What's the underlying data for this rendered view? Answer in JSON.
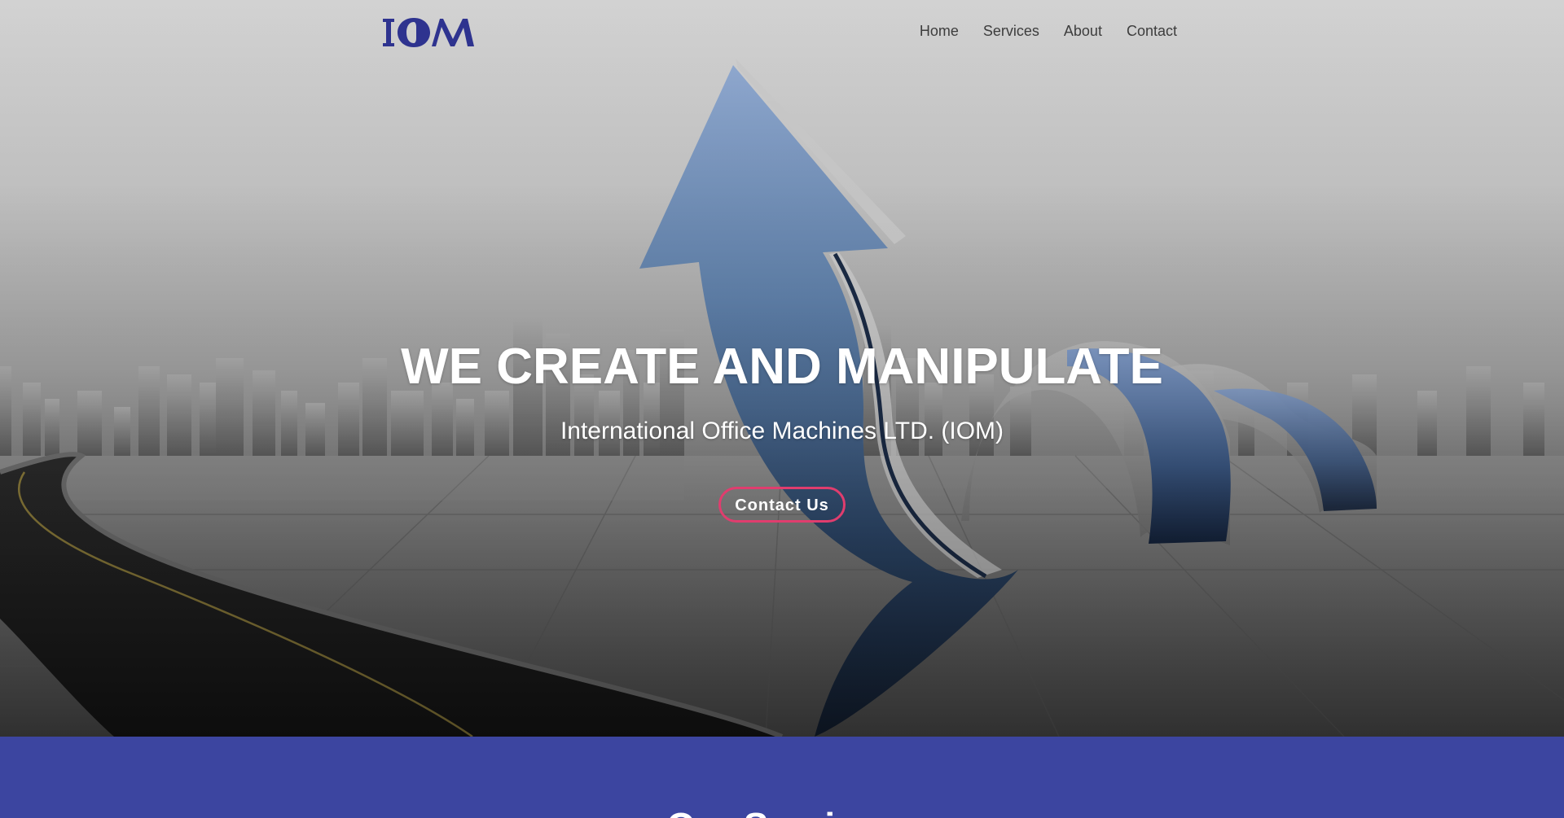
{
  "brand": {
    "logo_text": "IOM",
    "logo_color": "#2e338f"
  },
  "nav": {
    "items": [
      {
        "label": "Home"
      },
      {
        "label": "Services"
      },
      {
        "label": "About"
      },
      {
        "label": "Contact"
      }
    ]
  },
  "hero": {
    "title": "WE CREATE AND MANIPULATE",
    "subtitle": "International Office Machines LTD. (IOM)",
    "cta_label": "Contact Us",
    "cta_border_color": "#e03d6e"
  },
  "services": {
    "heading": "Our Services",
    "background_color": "#3c45a0"
  }
}
